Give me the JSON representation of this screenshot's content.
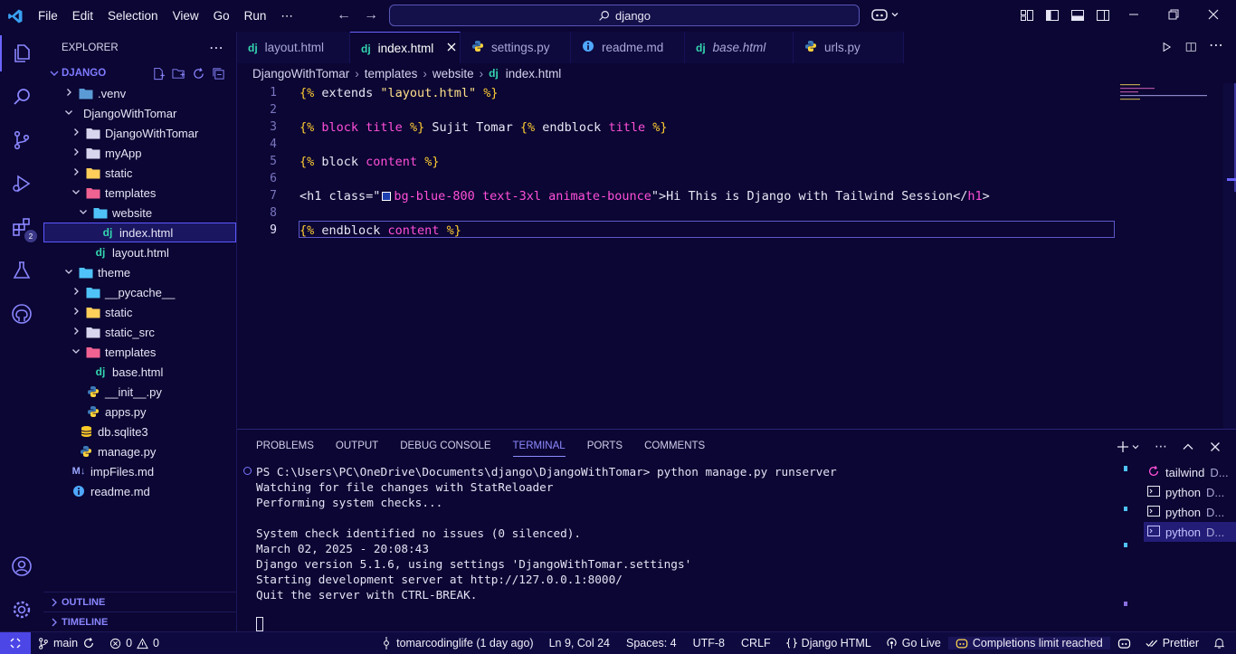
{
  "titlebar": {
    "menu": [
      "File",
      "Edit",
      "Selection",
      "View",
      "Go",
      "Run",
      "⋯"
    ],
    "search": "django"
  },
  "activity": {
    "extensions_badge": "2"
  },
  "sidebar": {
    "title": "EXPLORER",
    "project": "DJANGO",
    "tree": [
      {
        "label": ".venv",
        "depth": 1,
        "type": "folder",
        "open": false,
        "color": "#5b9bd5"
      },
      {
        "label": "DjangoWithTomar",
        "depth": 1,
        "type": "folder",
        "open": true,
        "color": "none"
      },
      {
        "label": "DjangoWithTomar",
        "depth": 2,
        "type": "folder",
        "open": false,
        "color": "#d8d6ee"
      },
      {
        "label": "myApp",
        "depth": 2,
        "type": "folder",
        "open": false,
        "color": "#d8d6ee"
      },
      {
        "label": "static",
        "depth": 2,
        "type": "folder",
        "open": false,
        "color": "#ffcf5a"
      },
      {
        "label": "templates",
        "depth": 2,
        "type": "folder",
        "open": true,
        "color": "#f06292"
      },
      {
        "label": "website",
        "depth": 3,
        "type": "folder",
        "open": true,
        "color": "#4fc3f7"
      },
      {
        "label": "index.html",
        "depth": 4,
        "type": "django",
        "selected": true
      },
      {
        "label": "layout.html",
        "depth": 3,
        "type": "django"
      },
      {
        "label": "theme",
        "depth": 1,
        "type": "folder",
        "open": true,
        "color": "#4fc3f7"
      },
      {
        "label": "__pycache__",
        "depth": 2,
        "type": "folder",
        "open": false,
        "color": "#4fc3f7"
      },
      {
        "label": "static",
        "depth": 2,
        "type": "folder",
        "open": false,
        "color": "#ffcf5a"
      },
      {
        "label": "static_src",
        "depth": 2,
        "type": "folder",
        "open": false,
        "color": "#d8d6ee"
      },
      {
        "label": "templates",
        "depth": 2,
        "type": "folder",
        "open": true,
        "color": "#f06292"
      },
      {
        "label": "base.html",
        "depth": 3,
        "type": "django"
      },
      {
        "label": "__init__.py",
        "depth": 2,
        "type": "python"
      },
      {
        "label": "apps.py",
        "depth": 2,
        "type": "python"
      },
      {
        "label": "db.sqlite3",
        "depth": 1,
        "type": "db"
      },
      {
        "label": "manage.py",
        "depth": 1,
        "type": "python"
      },
      {
        "label": "impFiles.md",
        "depth": 0,
        "type": "markdown"
      },
      {
        "label": "readme.md",
        "depth": 0,
        "type": "info"
      }
    ],
    "outline": "OUTLINE",
    "timeline": "TIMELINE"
  },
  "tabs": [
    {
      "label": "layout.html",
      "icon": "django",
      "active": false,
      "italic": false
    },
    {
      "label": "index.html",
      "icon": "django",
      "active": true,
      "italic": false
    },
    {
      "label": "settings.py",
      "icon": "python",
      "active": false,
      "italic": false
    },
    {
      "label": "readme.md",
      "icon": "info",
      "active": false,
      "italic": false
    },
    {
      "label": "base.html",
      "icon": "django",
      "active": false,
      "italic": true
    },
    {
      "label": "urls.py",
      "icon": "python",
      "active": false,
      "italic": false
    }
  ],
  "breadcrumb": [
    "DjangoWithTomar",
    "templates",
    "website",
    "index.html"
  ],
  "editor": {
    "lines": [
      {
        "n": "1",
        "parts": [
          [
            "tag",
            "{% "
          ],
          [
            "attr",
            "extends "
          ],
          [
            "str",
            "\"layout.html\""
          ],
          [
            "tag",
            " %}"
          ]
        ]
      },
      {
        "n": "2",
        "parts": []
      },
      {
        "n": "3",
        "parts": [
          [
            "tag",
            "{% "
          ],
          [
            "kw",
            "block "
          ],
          [
            "kw",
            "title "
          ],
          [
            "tag",
            "%}"
          ],
          [
            "attr",
            " Sujit Tomar "
          ],
          [
            "tag",
            "{% "
          ],
          [
            "attr",
            "endblock "
          ],
          [
            "kw",
            "title "
          ],
          [
            "tag",
            "%}"
          ]
        ]
      },
      {
        "n": "4",
        "parts": []
      },
      {
        "n": "5",
        "parts": [
          [
            "tag",
            "{% "
          ],
          [
            "attr",
            "block "
          ],
          [
            "kw",
            "content "
          ],
          [
            "tag",
            "%}"
          ]
        ]
      },
      {
        "n": "6",
        "parts": []
      },
      {
        "n": "7",
        "parts": [
          [
            "attr",
            "<h1 class=\""
          ],
          [
            "swatch",
            ""
          ],
          [
            "kw",
            "bg-blue-800 text-3xl animate-bounce"
          ],
          [
            "attr",
            "\">Hi This is Django with Tailwind Session</"
          ],
          [
            "kw",
            "h1"
          ],
          [
            "attr",
            ">"
          ]
        ]
      },
      {
        "n": "8",
        "parts": []
      },
      {
        "n": "9",
        "parts": [
          [
            "tag",
            "{% "
          ],
          [
            "attr",
            "endblock "
          ],
          [
            "kw",
            "content "
          ],
          [
            "tag",
            "%}"
          ]
        ]
      }
    ],
    "swatch_color": "#1e40af"
  },
  "panel": {
    "tabs": [
      "PROBLEMS",
      "OUTPUT",
      "DEBUG CONSOLE",
      "TERMINAL",
      "PORTS",
      "COMMENTS"
    ],
    "active_tab": "TERMINAL",
    "terminal": [
      "PS C:\\Users\\PC\\OneDrive\\Documents\\django\\DjangoWithTomar> python manage.py runserver",
      "Watching for file changes with StatReloader",
      "Performing system checks...",
      "",
      "System check identified no issues (0 silenced).",
      "March 02, 2025 - 20:08:43",
      "Django version 5.1.6, using settings 'DjangoWithTomar.settings'",
      "Starting development server at http://127.0.0.1:8000/",
      "Quit the server with CTRL-BREAK."
    ],
    "instances": [
      {
        "name": "tailwind",
        "suffix": "D...",
        "icon": "sync"
      },
      {
        "name": "python",
        "suffix": "D...",
        "icon": "terminal"
      },
      {
        "name": "python",
        "suffix": "D...",
        "icon": "terminal"
      },
      {
        "name": "python",
        "suffix": "D...",
        "icon": "terminal",
        "active": true
      }
    ]
  },
  "statusbar": {
    "branch": "main",
    "errors": "0",
    "warnings": "0",
    "blame": "tomarcodinglife (1 day ago)",
    "position": "Ln 9, Col 24",
    "spaces": "Spaces: 4",
    "encoding": "UTF-8",
    "eol": "CRLF",
    "language": "Django HTML",
    "golive": "Go Live",
    "completions": "Completions limit reached",
    "prettier": "Prettier"
  },
  "colors": {
    "accent": "#6a64ff",
    "background": "#0b0633",
    "keyword": "#ff4fd8",
    "tag": "#ffcc33"
  }
}
